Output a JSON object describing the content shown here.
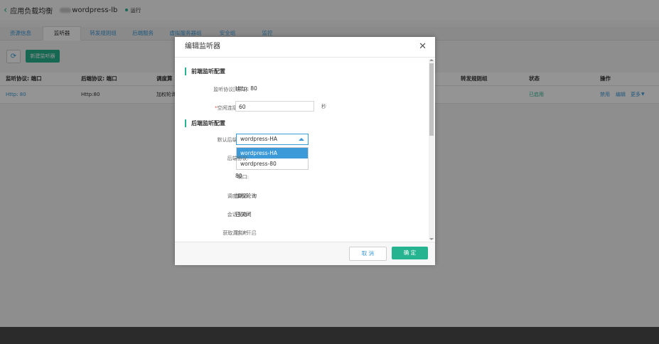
{
  "header": {
    "back_icon": "chevron-left-icon",
    "app_title": "应用负载均衡",
    "instance_name": "wordpress-lb",
    "status_text": "运行",
    "status_color": "#26b38f"
  },
  "tabs": [
    {
      "label": "资源信息",
      "active": false
    },
    {
      "label": "监听器",
      "active": true
    },
    {
      "label": "转发规则组",
      "active": false
    },
    {
      "label": "后端服务",
      "active": false
    },
    {
      "label": "虚拟服务器组",
      "active": false
    },
    {
      "label": "安全组",
      "active": false
    },
    {
      "label": "监控",
      "active": false
    }
  ],
  "toolbar": {
    "refresh_icon": "refresh-icon",
    "new_button_label": "新建监听器"
  },
  "table": {
    "columns": [
      "监听协议: 端口",
      "后端协议: 端口",
      "调度算",
      "转发规则组",
      "状态",
      "操作"
    ],
    "row": {
      "frontend": "Http: 80",
      "backend": "Http:80",
      "algorithm": "加权轮询",
      "status": "已启用",
      "actions": [
        "禁用",
        "编辑",
        "更多"
      ]
    }
  },
  "modal": {
    "title": "编辑监听器",
    "close_icon": "close-icon",
    "frontend_section": "前端监听配置",
    "listen_protocol_label": "监听协议[端口]:",
    "listen_protocol_value": "Http:  80",
    "idle_timeout_label": "*空闲连接超时:",
    "idle_timeout_value": "60",
    "idle_timeout_unit": "秒",
    "backend_section": "后端监听配置",
    "default_backend_label": "默认后端服务:",
    "default_backend_value": "wordpress-HA",
    "dropdown_options": [
      "wordpress-HA",
      "wordpress-80"
    ],
    "backend_protocol_label": "后端协议:",
    "port_label": "端口:",
    "port_value": "80",
    "algorithm_label": "调度算法:",
    "algorithm_value": "加权轮询",
    "session_label": "会话保持:",
    "session_value": "已关闭",
    "real_ip_label": "获取真实IP:",
    "real_ip_value": "默认开启",
    "cancel_label": "取 消",
    "ok_label": "确 定"
  },
  "colors": {
    "accent_green": "#26b38f",
    "link_blue": "#3d9ad8"
  }
}
